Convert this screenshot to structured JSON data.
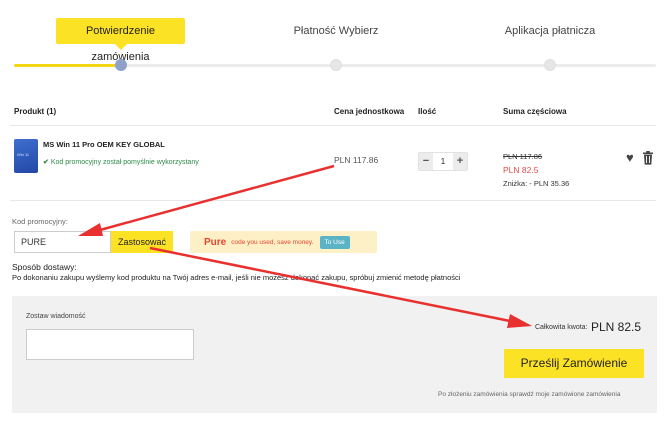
{
  "steps": [
    {
      "label": "Potwierdzenie zamówienia",
      "active": true
    },
    {
      "label": "Płatność Wybierz",
      "active": false
    },
    {
      "label": "Aplikacja płatnicza",
      "active": false
    }
  ],
  "table": {
    "headers": {
      "product": "Produkt (1)",
      "unit_price": "Cena jednostkowa",
      "quantity": "Ilość",
      "subtotal": "Suma częściowa"
    },
    "row": {
      "image_text": "Win 11",
      "name": "MS Win 11 Pro OEM KEY GLOBAL",
      "promo_status": "Kod promocyjny został pomyślnie wykorzystany",
      "unit_price": "PLN 117.86",
      "qty_minus": "−",
      "quantity": "1",
      "qty_plus": "+",
      "old_price": "PLN 117.86",
      "new_price": "PLN 82.5",
      "discount": "Zniżka: - PLN 35.36",
      "favorite_icon": "heart-icon",
      "delete_icon": "trash-icon"
    }
  },
  "promo": {
    "label": "Kod promocyjny:",
    "input_value": "PURE",
    "apply_label": "Zastosować",
    "banner": {
      "code": "Pure",
      "message": "code you used, save money.",
      "use_label": "To Use"
    }
  },
  "shipping": {
    "label": "Sposób dostawy:",
    "info": "Po dokonaniu zakupu wyślemy kod produktu na Twój adres e-mail, jeśli nie możesz dokonać zakupu, spróbuj zmienić metodę płatności"
  },
  "checkout": {
    "message_label": "Zostaw wiadomość",
    "total_label": "Całkowita kwota:",
    "total_value": "PLN 82.5",
    "submit_label": "Prześlij Zamówienie",
    "after_note": "Po złożeniu zamówienia sprawdź moje zamówione zamówienia"
  },
  "colors": {
    "accent": "#fce225",
    "annotation_arrow": "#e8302f",
    "discount_red": "#e44b4b",
    "success_green": "#2f8a4a",
    "step_dot_active": "#8fa1c8"
  }
}
